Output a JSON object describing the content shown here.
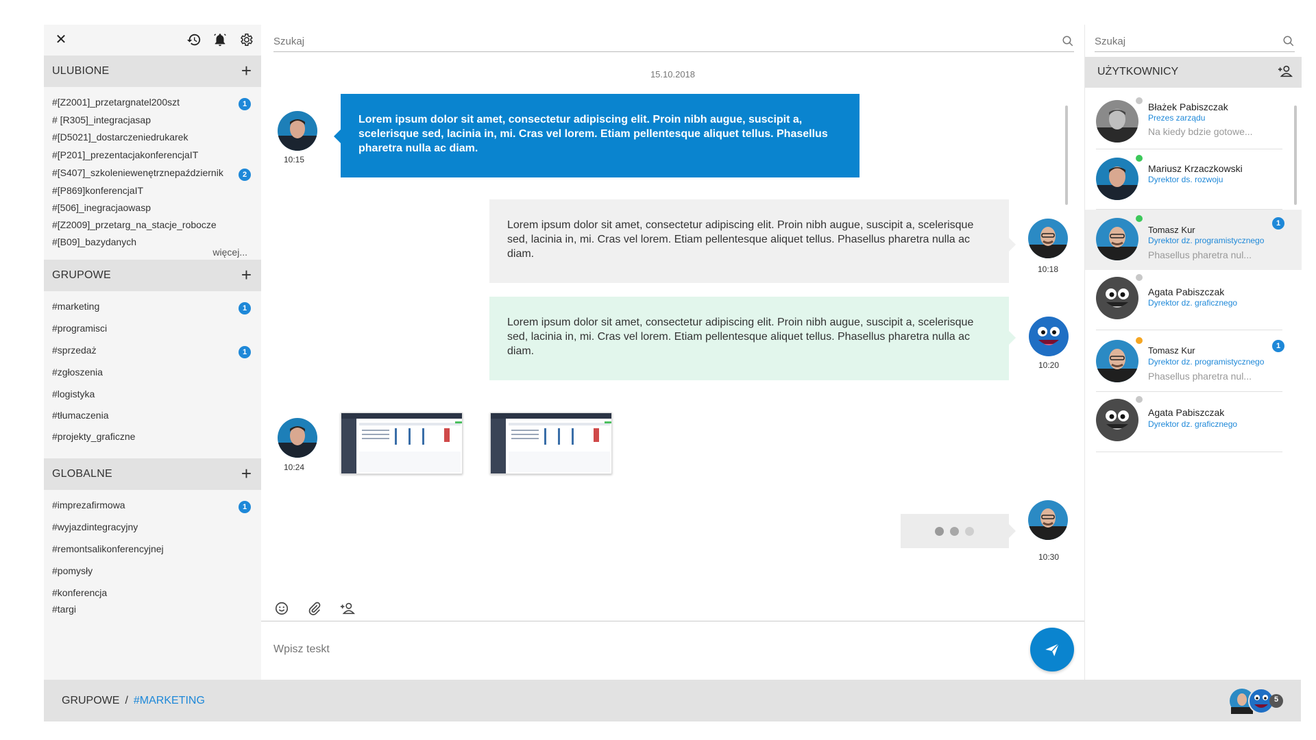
{
  "sidebar": {
    "sections": [
      {
        "title": "ULUBIONE",
        "items": [
          {
            "label": "#[Z2001]_przetargnatel200szt",
            "badge": "1"
          },
          {
            "label": "# [R305]_integracjasap",
            "badge": ""
          },
          {
            "label": "#[D5021]_dostarczeniedrukarek",
            "badge": ""
          },
          {
            "label": "#[P201]_prezentacjakonferencjaIT",
            "badge": ""
          },
          {
            "label": "#[S407]_szkoleniewenętrznepaździernik",
            "badge": "2"
          },
          {
            "label": "#[P869]konferencjaIT",
            "badge": ""
          },
          {
            "label": "#[506]_inegracjaowasp",
            "badge": ""
          },
          {
            "label": "#[Z2009]_przetarg_na_stacje_robocze",
            "badge": ""
          },
          {
            "label": "#[B09]_bazydanych",
            "badge": ""
          }
        ],
        "more": "więcej..."
      },
      {
        "title": "GRUPOWE",
        "items": [
          {
            "label": "#marketing",
            "badge": "1"
          },
          {
            "label": "#programisci",
            "badge": ""
          },
          {
            "label": "#sprzedaż",
            "badge": "1"
          },
          {
            "label": "#zgłoszenia",
            "badge": ""
          },
          {
            "label": "#logistyka",
            "badge": ""
          },
          {
            "label": "#tłumaczenia",
            "badge": ""
          },
          {
            "label": "#projekty_graficzne",
            "badge": ""
          }
        ]
      },
      {
        "title": "GLOBALNE",
        "items": [
          {
            "label": "#imprezafirmowa",
            "badge": "1"
          },
          {
            "label": "#wyjazdintegracyjny",
            "badge": ""
          },
          {
            "label": "#remontsalikonferencyjnej",
            "badge": ""
          },
          {
            "label": "#pomysły",
            "badge": ""
          },
          {
            "label": "#konferencja",
            "badge": ""
          },
          {
            "label": "#targi",
            "badge": ""
          }
        ]
      }
    ]
  },
  "chat": {
    "search_placeholder": "Szukaj",
    "date": "15.10.2018",
    "messages": [
      {
        "time": "10:15",
        "text": "Lorem ipsum dolor sit amet, consectetur adipiscing elit. Proin nibh augue, suscipit a, scelerisque sed, lacinia in, mi. Cras vel lorem. Etiam pellentesque aliquet tellus. Phasellus pharetra nulla ac diam."
      },
      {
        "time": "10:18",
        "text": "Lorem ipsum dolor sit amet, consectetur adipiscing elit. Proin nibh augue, suscipit a, scelerisque sed, lacinia in, mi. Cras vel lorem. Etiam pellentesque aliquet tellus. Phasellus pharetra nulla ac diam."
      },
      {
        "time": "10:20",
        "text": "Lorem ipsum dolor sit amet, consectetur adipiscing elit. Proin nibh augue, suscipit a, scelerisque sed, lacinia in, mi. Cras vel lorem. Etiam pellentesque aliquet tellus. Phasellus pharetra nulla ac diam."
      },
      {
        "time": "10:24"
      },
      {
        "time": "10:30"
      }
    ],
    "composer_placeholder": "Wpisz teskt",
    "colors": {
      "accent": "#0a84cf",
      "incoming": "#f0f0f0",
      "outgoing_green": "#e2f6ec"
    }
  },
  "users": {
    "search_placeholder": "Szukaj",
    "title": "UŻYTKOWNICY",
    "list": [
      {
        "name": "Błażek Pabiszczak",
        "role": "Prezes zarządu",
        "message": "Na kiedy bdzie gotowe...",
        "status_color": "#c8c8c8",
        "badge": ""
      },
      {
        "name": "Mariusz Krzaczkowski",
        "role": "Dyrektor ds. rozwoju",
        "message": "",
        "status_color": "#3cc85a",
        "badge": ""
      },
      {
        "name": "Tomasz Kur",
        "role": "Dyrektor dz. programistycznego",
        "message": "Phasellus pharetra nul...",
        "status_color": "#3cc85a",
        "badge": "1"
      },
      {
        "name": "Agata Pabiszczak",
        "role": "Dyrektor dz. graficznego",
        "message": "",
        "status_color": "#c8c8c8",
        "badge": ""
      },
      {
        "name": "Tomasz Kur",
        "role": "Dyrektor dz. programistycznego",
        "message": "Phasellus pharetra nul...",
        "status_color": "#f5a623",
        "badge": "1"
      },
      {
        "name": "Agata Pabiszczak",
        "role": "Dyrektor dz. graficznego",
        "message": "",
        "status_color": "#c8c8c8",
        "badge": ""
      }
    ]
  },
  "footer": {
    "section": "GRUPOWE",
    "separator": "/",
    "channel": "#MARKETING",
    "members_count": "5"
  }
}
